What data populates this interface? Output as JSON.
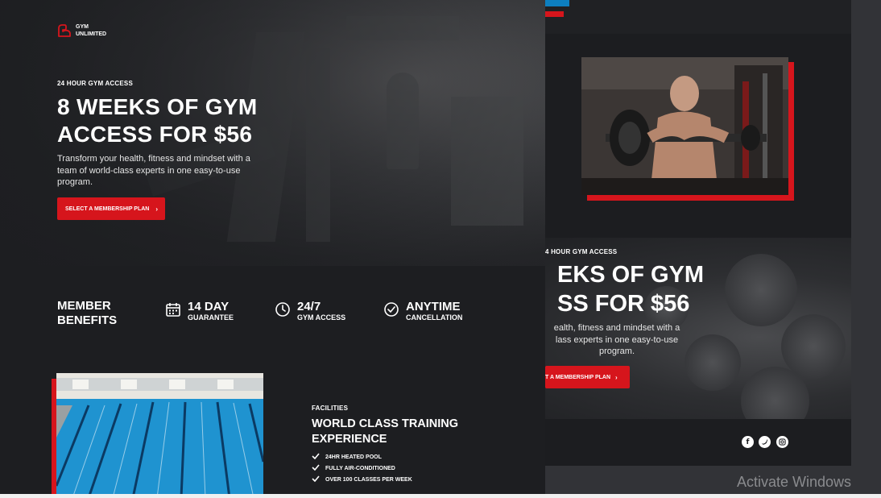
{
  "logo": {
    "line1": "GYM",
    "line2": "UNLIMITED"
  },
  "hero": {
    "eyebrow": "24 HOUR GYM ACCESS",
    "title_line1": "8 WEEKS OF GYM",
    "title_line2": "ACCESS FOR $56",
    "description": "Transform your health, fitness and mindset with a team of world-class experts in one easy-to-use program.",
    "cta_label": "SELECT A MEMBERSHIP PLAN",
    "cta_icon": "chevron-right-icon"
  },
  "benefits": {
    "title_line1": "MEMBER",
    "title_line2": "BENEFITS",
    "items": [
      {
        "big": "14 DAY",
        "small": "GUARANTEE",
        "icon": "calendar-icon"
      },
      {
        "big": "24/7",
        "small": "GYM ACCESS",
        "icon": "clock-icon"
      },
      {
        "big": "ANYTIME",
        "small": "CANCELLATION",
        "icon": "check-circle-icon"
      }
    ]
  },
  "facilities": {
    "eyebrow": "FACILITIES",
    "title_line1": "WORLD CLASS TRAINING",
    "title_line2": "EXPERIENCE",
    "items": [
      "24HR HEATED POOL",
      "FULLY AIR-CONDITIONED",
      "OVER 100 CLASSES PER WEEK"
    ]
  },
  "second_preview": {
    "eyebrow": "4 HOUR GYM ACCESS",
    "title_line1": "EKS OF GYM",
    "title_line2": "SS FOR $56",
    "description_line1": "ealth, fitness and mindset with a",
    "description_line2": "lass experts in one easy-to-use",
    "description_line3": "program.",
    "cta_label": "T A MEMBERSHIP PLAN",
    "social": [
      "facebook-icon",
      "twitter-icon",
      "instagram-icon"
    ]
  },
  "watermark": "Activate Windows",
  "colors": {
    "accent": "#d6151c",
    "background": "#1d1e21",
    "pool": "#2a9bd4"
  }
}
